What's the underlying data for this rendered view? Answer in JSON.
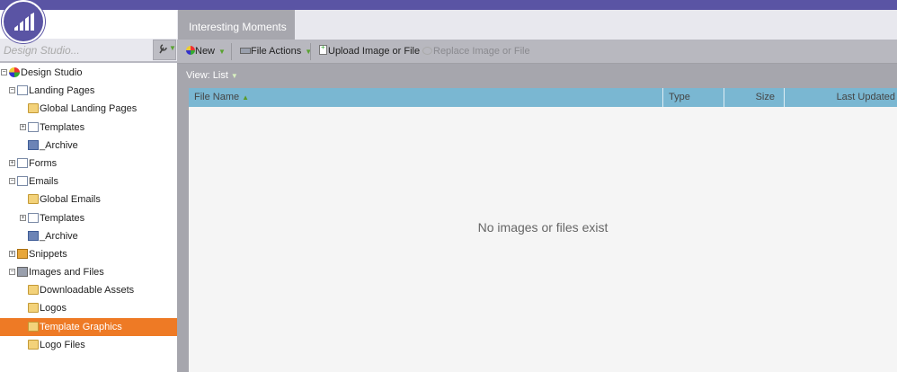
{
  "app": {
    "accent": "#5a54a4",
    "highlight": "#ee7a25"
  },
  "sidebar": {
    "search_placeholder": "Design Studio...",
    "tool_icon": "wrench-icon",
    "tree": [
      {
        "label": "Design Studio",
        "icon": "design-studio-icon",
        "expander": "collapse"
      },
      {
        "label": "Landing Pages",
        "icon": "landing-pages-icon",
        "expander": "collapse"
      },
      {
        "label": "Global Landing Pages",
        "icon": "folder-icon"
      },
      {
        "label": "Templates",
        "icon": "template-icon",
        "expander": "expand"
      },
      {
        "label": "_Archive",
        "icon": "archive-icon"
      },
      {
        "label": "Forms",
        "icon": "forms-icon",
        "expander": "expand"
      },
      {
        "label": "Emails",
        "icon": "emails-icon",
        "expander": "collapse"
      },
      {
        "label": "Global Emails",
        "icon": "folder-icon"
      },
      {
        "label": "Templates",
        "icon": "template-icon",
        "expander": "expand"
      },
      {
        "label": "_Archive",
        "icon": "archive-icon"
      },
      {
        "label": "Snippets",
        "icon": "snippets-icon",
        "expander": "expand"
      },
      {
        "label": "Images and Files",
        "icon": "images-files-icon",
        "expander": "collapse"
      },
      {
        "label": "Downloadable Assets",
        "icon": "folder-icon"
      },
      {
        "label": "Logos",
        "icon": "folder-icon"
      },
      {
        "label": "Template Graphics",
        "icon": "folder-icon",
        "selected": true
      },
      {
        "label": "Logo Files",
        "icon": "folder-icon"
      }
    ]
  },
  "tabs": [
    {
      "label": "Interesting Moments"
    }
  ],
  "toolbar": {
    "new_label": "New",
    "file_actions_label": "File Actions",
    "upload_label": "Upload Image or File",
    "replace_label": "Replace Image or File"
  },
  "view": {
    "label": "View: List"
  },
  "grid": {
    "columns": [
      "File Name",
      "Type",
      "Size",
      "Last Updated"
    ],
    "empty_message": "No images or files exist"
  }
}
